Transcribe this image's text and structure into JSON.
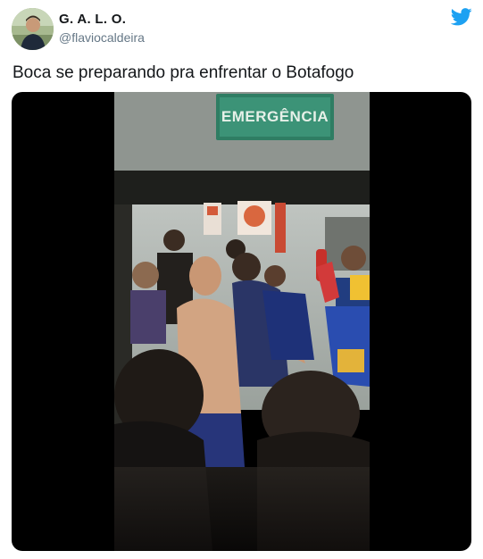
{
  "tweet": {
    "author": {
      "display_name": "G. A. L. O.",
      "handle": "@flaviocaldeira"
    },
    "text": "Boca se preparando pra enfrentar o Botafogo",
    "media": {
      "type": "video",
      "sign_text": "EMERGÊNCIA"
    }
  },
  "colors": {
    "brand": "#1da1f2",
    "handle": "#657786",
    "text": "#14171a"
  }
}
